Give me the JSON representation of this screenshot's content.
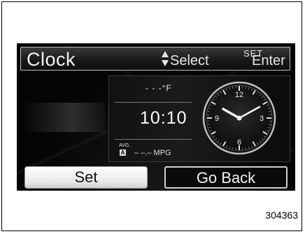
{
  "header": {
    "title": "Clock"
  },
  "hints": {
    "select_label": "Select",
    "set_label": "SET",
    "enter_label": "Enter",
    "select_icon": "up-down-arrows-icon"
  },
  "info": {
    "temperature": "- - -°F",
    "time": "10:10",
    "avg_label": "AVG.",
    "avg_badge": "A",
    "mpg": "– –.– MPG"
  },
  "clock": {
    "numerals": [
      "12",
      "3",
      "6",
      "9"
    ],
    "time_shown": "10:10"
  },
  "buttons": {
    "set": "Set",
    "go_back": "Go Back"
  },
  "figure_code": "304363",
  "colors": {
    "screen_bg": "#050505",
    "text": "#f2f2f2",
    "selected_button": "#ffffff"
  }
}
